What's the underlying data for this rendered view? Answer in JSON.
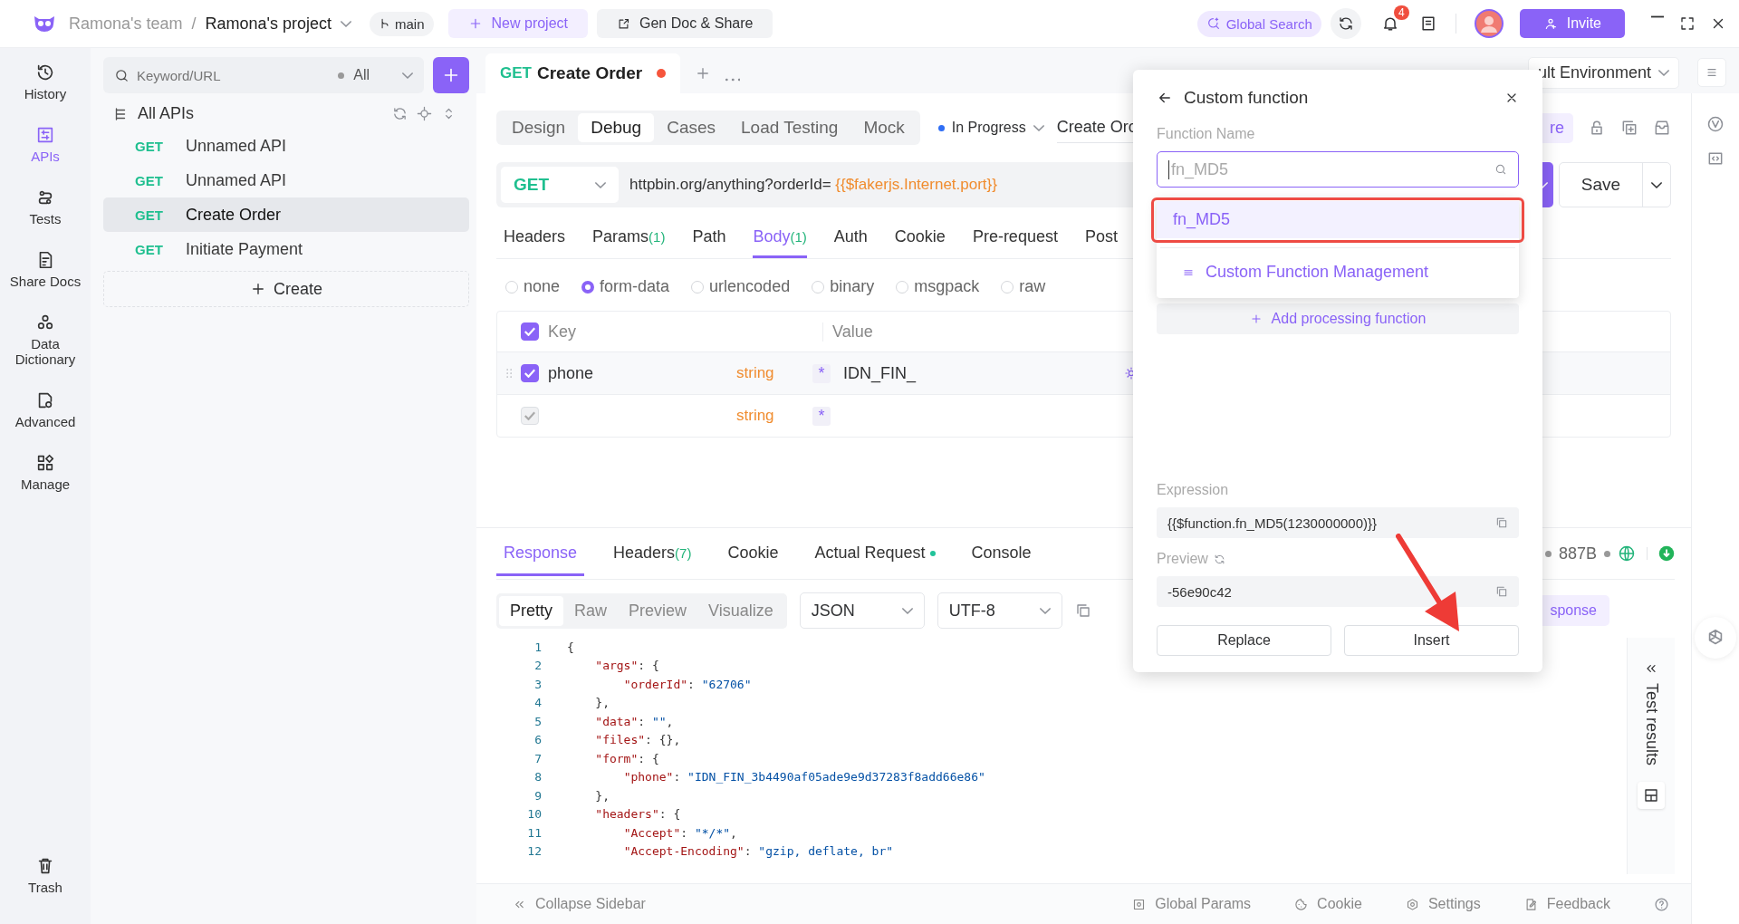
{
  "title_bar": {
    "team": "Ramona's team",
    "separator": "/",
    "project": "Ramona's project",
    "branch": "main",
    "new_project": "New project",
    "gen_doc": "Gen Doc & Share",
    "global_search": "Global Search",
    "notification_count": "4",
    "invite": "Invite"
  },
  "rail": [
    {
      "label": "History",
      "selected": false
    },
    {
      "label": "APIs",
      "selected": true
    },
    {
      "label": "Tests",
      "selected": false
    },
    {
      "label": "Share Docs",
      "selected": false
    },
    {
      "label": "Data Dictionary",
      "selected": false
    },
    {
      "label": "Advanced",
      "selected": false
    },
    {
      "label": "Manage",
      "selected": false
    }
  ],
  "rail_bottom": {
    "label": "Trash"
  },
  "api_sidebar": {
    "search_placeholder": "Keyword/URL",
    "filter": "All",
    "root": "All APIs",
    "items": [
      {
        "method": "GET",
        "name": "Unnamed API",
        "selected": false
      },
      {
        "method": "GET",
        "name": "Unnamed API",
        "selected": false
      },
      {
        "method": "GET",
        "name": "Create Order",
        "selected": true
      },
      {
        "method": "GET",
        "name": "Initiate Payment",
        "selected": false
      }
    ],
    "create": "Create"
  },
  "tabs": [
    {
      "method": "GET",
      "title": "Create Order",
      "unsaved": true,
      "selected": true
    }
  ],
  "environment": "ult Environment",
  "mode_tabs": [
    {
      "label": "Design",
      "selected": false
    },
    {
      "label": "Debug",
      "selected": true
    },
    {
      "label": "Cases",
      "selected": false
    },
    {
      "label": "Load Testing",
      "selected": false
    },
    {
      "label": "Mock",
      "selected": false
    }
  ],
  "status": "In Progress",
  "api_name": "Create Orc",
  "share_fragment": "re",
  "request": {
    "method": "GET",
    "url": "httpbin.org/anything?orderId= ",
    "url_variable": "{{$fakerjs.Internet.port}}",
    "save": "Save"
  },
  "request_tabs": [
    {
      "label": "Headers",
      "selected": false
    },
    {
      "label": "Params",
      "count": "(1)",
      "selected": false
    },
    {
      "label": "Path",
      "selected": false
    },
    {
      "label": "Body",
      "count": "(1)",
      "selected": true
    },
    {
      "label": "Auth",
      "selected": false
    },
    {
      "label": "Cookie",
      "selected": false
    },
    {
      "label": "Pre-request",
      "selected": false
    },
    {
      "label": "Post",
      "selected": false
    }
  ],
  "body_types": [
    {
      "label": "none",
      "selected": false
    },
    {
      "label": "form-data",
      "selected": true
    },
    {
      "label": "urlencoded",
      "selected": false
    },
    {
      "label": "binary",
      "selected": false
    },
    {
      "label": "msgpack",
      "selected": false
    },
    {
      "label": "raw",
      "selected": false
    }
  ],
  "table": {
    "columns": [
      "Key",
      "Value"
    ],
    "header_checked": true,
    "rows": [
      {
        "key": "phone",
        "type": "string",
        "required_mark": "*",
        "value": "IDN_FIN_",
        "checked": true,
        "disabled": false
      },
      {
        "type": "string",
        "required_mark": "*",
        "checked": true,
        "disabled": true
      }
    ]
  },
  "popup": {
    "title": "Custom function",
    "field_label": "Function Name",
    "search_value": "fn_MD5",
    "options": [
      {
        "label": "fn_MD5",
        "selected": true
      }
    ],
    "manage": "Custom Function Management",
    "add_function": "Add processing function",
    "expression_label": "Expression",
    "expression": "{{$function.fn_MD5(1230000000)}}",
    "preview_label": "Preview",
    "preview": "-56e90c42",
    "buttons": [
      "Replace",
      "Insert"
    ]
  },
  "response_tabs": [
    {
      "label": "Response",
      "selected": true
    },
    {
      "label": "Headers",
      "count": "(7)",
      "selected": false
    },
    {
      "label": "Cookie",
      "selected": false
    },
    {
      "label": "Actual Request",
      "dot": true,
      "selected": false
    },
    {
      "label": "Console",
      "selected": false
    }
  ],
  "response_size": "887B",
  "view_tabs": [
    {
      "label": "Pretty",
      "selected": true
    },
    {
      "label": "Raw",
      "selected": false
    },
    {
      "label": "Preview",
      "selected": false
    },
    {
      "label": "Visualize",
      "selected": false
    }
  ],
  "format": "JSON",
  "encoding": "UTF-8",
  "response_fragment": "sponse",
  "code_lines": [
    {
      "number": "1",
      "text": "{"
    },
    {
      "number": "2",
      "text": "    \"args\": {"
    },
    {
      "number": "3",
      "text": "        \"orderId\": \"62706\""
    },
    {
      "number": "4",
      "text": "    },"
    },
    {
      "number": "5",
      "text": "    \"data\": \"\","
    },
    {
      "number": "6",
      "text": "    \"files\": {},"
    },
    {
      "number": "7",
      "text": "    \"form\": {"
    },
    {
      "number": "8",
      "text": "        \"phone\": \"IDN_FIN_3b4490af05ade9e9d37283f8add66e86\""
    },
    {
      "number": "9",
      "text": "    },"
    },
    {
      "number": "10",
      "text": "    \"headers\": {"
    },
    {
      "number": "11",
      "text": "        \"Accept\": \"*/*\","
    },
    {
      "number": "12",
      "text": "        \"Accept-Encoding\": \"gzip, deflate, br\""
    }
  ],
  "test_results": "Test results",
  "footer": {
    "collapse": "Collapse Sidebar",
    "items": [
      "Global Params",
      "Cookie",
      "Settings",
      "Feedback"
    ]
  }
}
